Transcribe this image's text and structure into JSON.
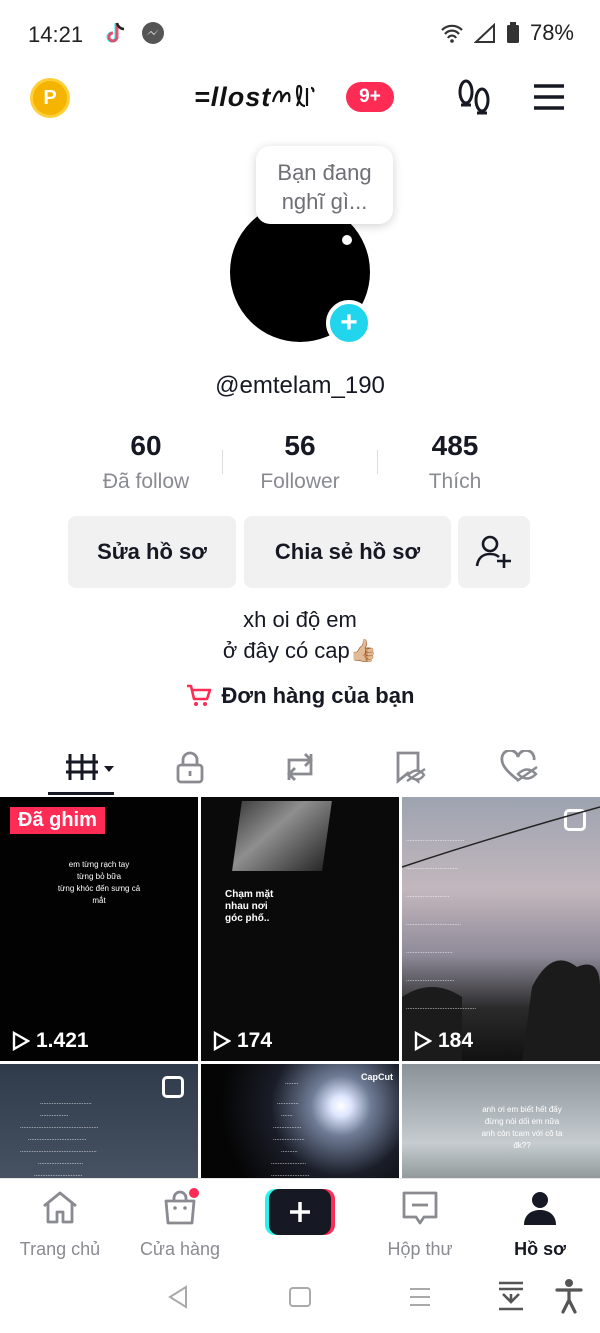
{
  "status_bar": {
    "time": "14:21",
    "battery": "78%"
  },
  "top_bar": {
    "logo_text": "=llost",
    "notification_badge": "9+"
  },
  "profile": {
    "thought_bubble": "Bạn đang nghĩ gì...",
    "username": "@emtelam_190",
    "stats": [
      {
        "value": "60",
        "label": "Đã follow"
      },
      {
        "value": "56",
        "label": "Follower"
      },
      {
        "value": "485",
        "label": "Thích"
      }
    ],
    "buttons": {
      "edit": "Sửa hồ sơ",
      "share": "Chia sẻ hồ sơ"
    },
    "bio_line1": "xh oi độ em",
    "bio_line2": "ở đây có cap👍🏼",
    "orders_label": "Đơn hàng của bạn"
  },
  "videos": [
    {
      "plays": "1.421",
      "pinned_label": "Đã ghim",
      "caption": "em từng rạch tay\ntừng bỏ bữa\ntừng khóc đến sưng cả\nmắt"
    },
    {
      "plays": "174",
      "caption": "Chạm mặt\nnhau nơi\ngóc phố.."
    },
    {
      "plays": "184",
      "caption": ""
    },
    {
      "plays": "",
      "caption": ""
    },
    {
      "plays": "",
      "overlay": "CapCut",
      "caption": ""
    },
    {
      "plays": "",
      "caption": "anh ơi em biết hết đấy\nđừng nói dối em nữa\nanh còn tcam với cô ta\nđk??"
    }
  ],
  "bottom_nav": [
    {
      "label": "Trang chủ"
    },
    {
      "label": "Cửa hàng"
    },
    {
      "label": "Hộp thư"
    },
    {
      "label": "Hồ sơ"
    }
  ],
  "colors": {
    "accent": "#fe2c55",
    "cyan": "#20d5ec",
    "text": "#161823",
    "muted": "#8a8b91"
  }
}
